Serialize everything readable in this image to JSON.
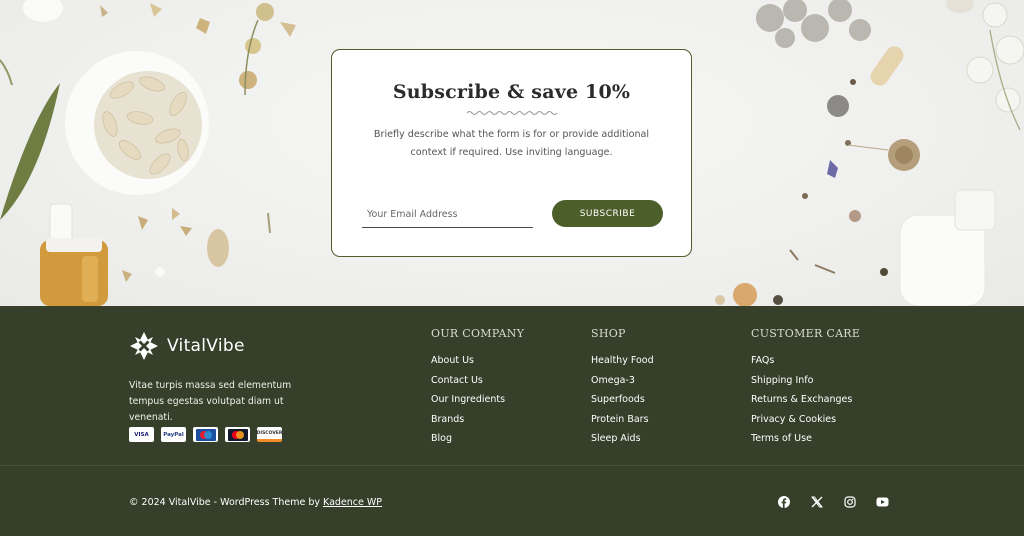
{
  "subscribe": {
    "title": "Subscribe & save 10%",
    "description": "Briefly describe what the form is for or provide additional context if required. Use inviting language.",
    "email_placeholder": "Your Email Address",
    "button_label": "SUBSCRIBE"
  },
  "footer": {
    "brand_name": "VitalVibe",
    "tagline": "Vitae turpis massa sed elementum tempus egestas volutpat diam ut venenati.",
    "payment_icons": [
      "visa-icon",
      "paypal-icon",
      "maestro-icon",
      "mastercard-icon",
      "discover-icon"
    ],
    "payment_labels": {
      "visa": "VISA",
      "paypal": "PayPal",
      "discover": "DISCOVER"
    },
    "columns": [
      {
        "title": "OUR COMPANY",
        "links": [
          "About Us",
          "Contact Us",
          "Our Ingredients",
          "Brands",
          "Blog"
        ]
      },
      {
        "title": "SHOP",
        "links": [
          "Healthy Food",
          "Omega-3",
          "Superfoods",
          "Protein Bars",
          "Sleep Aids"
        ]
      },
      {
        "title": "CUSTOMER CARE",
        "links": [
          "FAQs",
          "Shipping Info",
          "Returns & Exchanges",
          "Privacy & Cookies",
          "Terms of Use"
        ]
      }
    ],
    "copyright_prefix": "© 2024 VitalVibe - WordPress Theme by",
    "copyright_link": "Kadence WP",
    "social_icons": [
      "facebook-icon",
      "x-twitter-icon",
      "instagram-icon",
      "youtube-icon"
    ]
  },
  "colors": {
    "accent_green": "#4c5f2b",
    "footer_bg": "#353f2a",
    "card_border": "#4e5e2c"
  }
}
